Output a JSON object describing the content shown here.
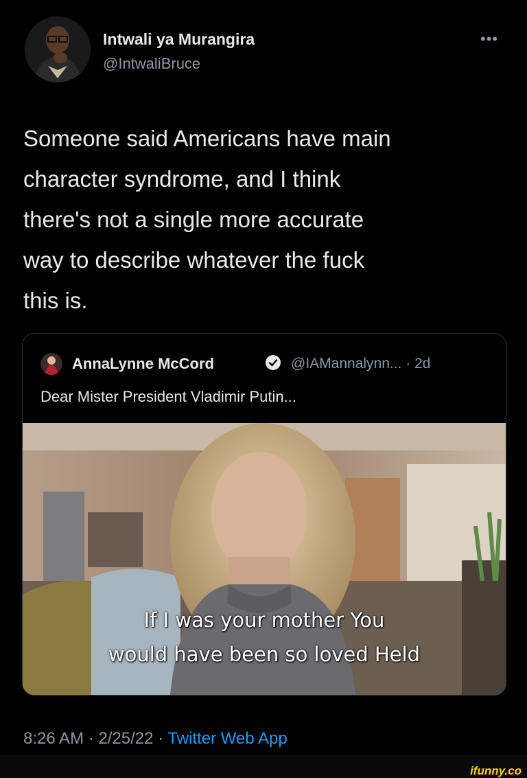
{
  "author": {
    "name": "Intwali ya Murangira",
    "handle": "@IntwaliBruce",
    "avatar_icon": "profile-photo"
  },
  "more_icon": "more-dots-icon",
  "more_glyph": "•••",
  "tweet": {
    "text_lines": [
      "Someone said Americans have main",
      "character syndrome, and I think",
      "there's not a single more accurate",
      "way to describe whatever the fuck",
      "this is."
    ]
  },
  "quoted": {
    "name": "AnnaLynne McCord",
    "verified_icon": "verified-badge-icon",
    "handle_time": "@IAMannalynn... · 2d",
    "text": "Dear Mister President Vladimir Putin...",
    "media": {
      "caption_line1": "If I was your mother You",
      "caption_line2": "would have been so loved Held"
    }
  },
  "meta": {
    "timestamp": "8:26 AM · 2/25/22 · ",
    "app": "Twitter Web App"
  },
  "watermark": "ifunny.co",
  "colors": {
    "background": "#000000",
    "link_blue": "#1d9bf0",
    "secondary_text": "#8b98a5",
    "watermark": "#ffd400"
  }
}
